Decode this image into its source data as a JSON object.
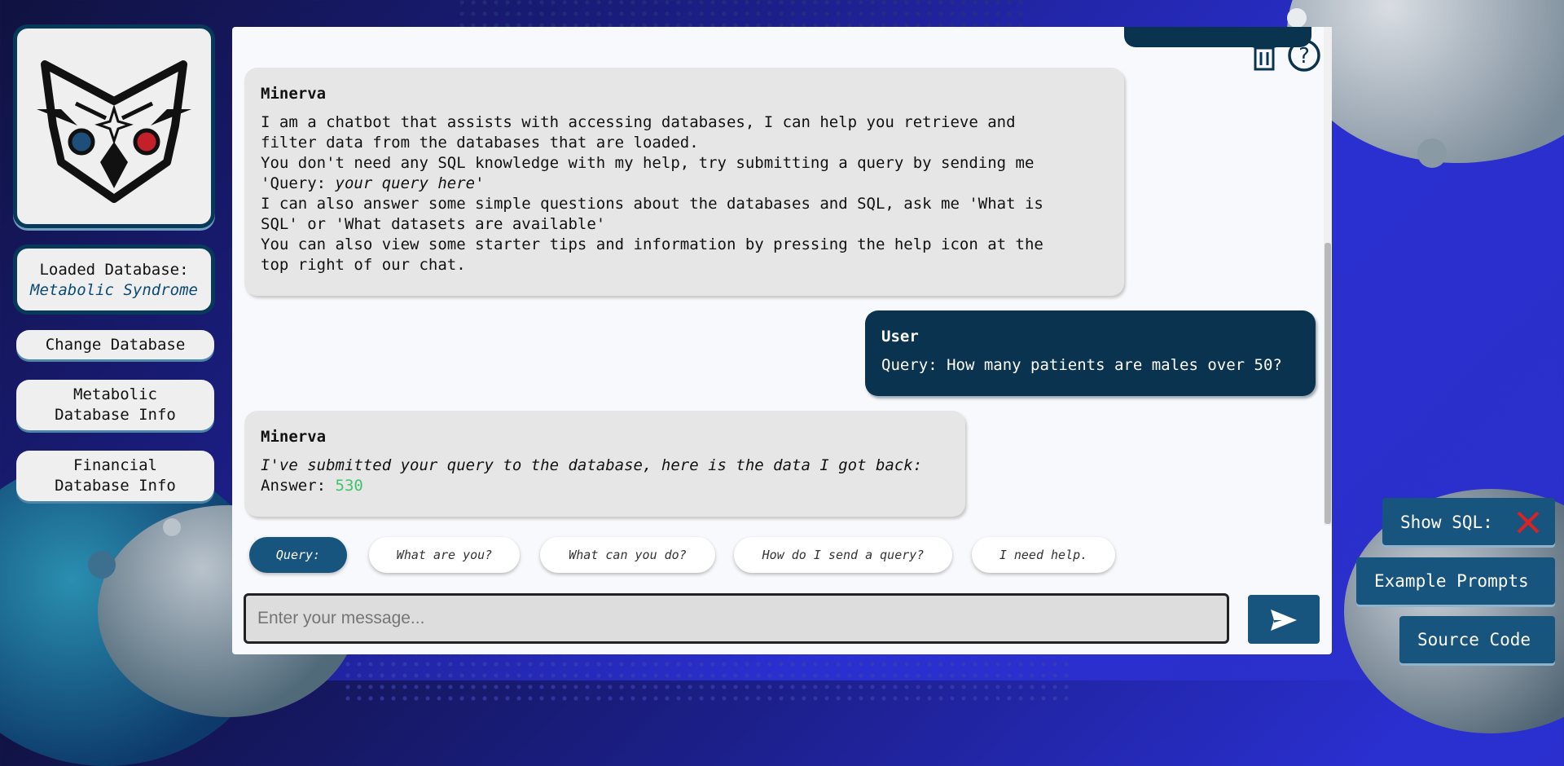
{
  "sidebar": {
    "loaded_label": "Loaded Database:",
    "loaded_name": "Metabolic Syndrome",
    "buttons": [
      {
        "line1": "Change Database",
        "line2": ""
      },
      {
        "line1": "Metabolic",
        "line2": "Database Info"
      },
      {
        "line1": "Financial",
        "line2": "Database Info"
      }
    ]
  },
  "chat": {
    "messages": [
      {
        "sender": "Minerva",
        "lines": [
          "I am a chatbot that assists with accessing databases, I can help you retrieve and",
          "filter data from the databases that are loaded.",
          "You don't need any SQL knowledge with my help, try submitting a query by sending me",
          "I can also answer some simple questions about the databases and SQL, ask me 'What is",
          "SQL' or 'What datasets are available'",
          "You can also view some starter tips and information by pressing the help icon at the",
          "top right of our chat."
        ],
        "query_prefix": "'Query: ",
        "query_italic": "your query here",
        "query_suffix": "'"
      },
      {
        "sender": "User",
        "text": "Query: How many patients are males over 50?"
      },
      {
        "sender": "Minerva",
        "intro": "I've submitted your query to the database, here is the data I got back:",
        "answer_label": "Answer: ",
        "answer_value": "530"
      }
    ]
  },
  "suggestions": [
    "Query:",
    "What are you?",
    "What can you do?",
    "How do I send a query?",
    "I need help."
  ],
  "input": {
    "placeholder": "Enter your message..."
  },
  "right_buttons": {
    "show_sql": "Show SQL:",
    "example_prompts": "Example Prompts",
    "source_code": "Source Code"
  },
  "colors": {
    "accent": "#17557f",
    "user_bubble": "#0a3350",
    "answer": "#3ec46d",
    "sql_off": "#e02020"
  },
  "icons": [
    "owl-logo-icon",
    "trash-icon",
    "help-icon",
    "send-icon",
    "close-x-icon"
  ]
}
